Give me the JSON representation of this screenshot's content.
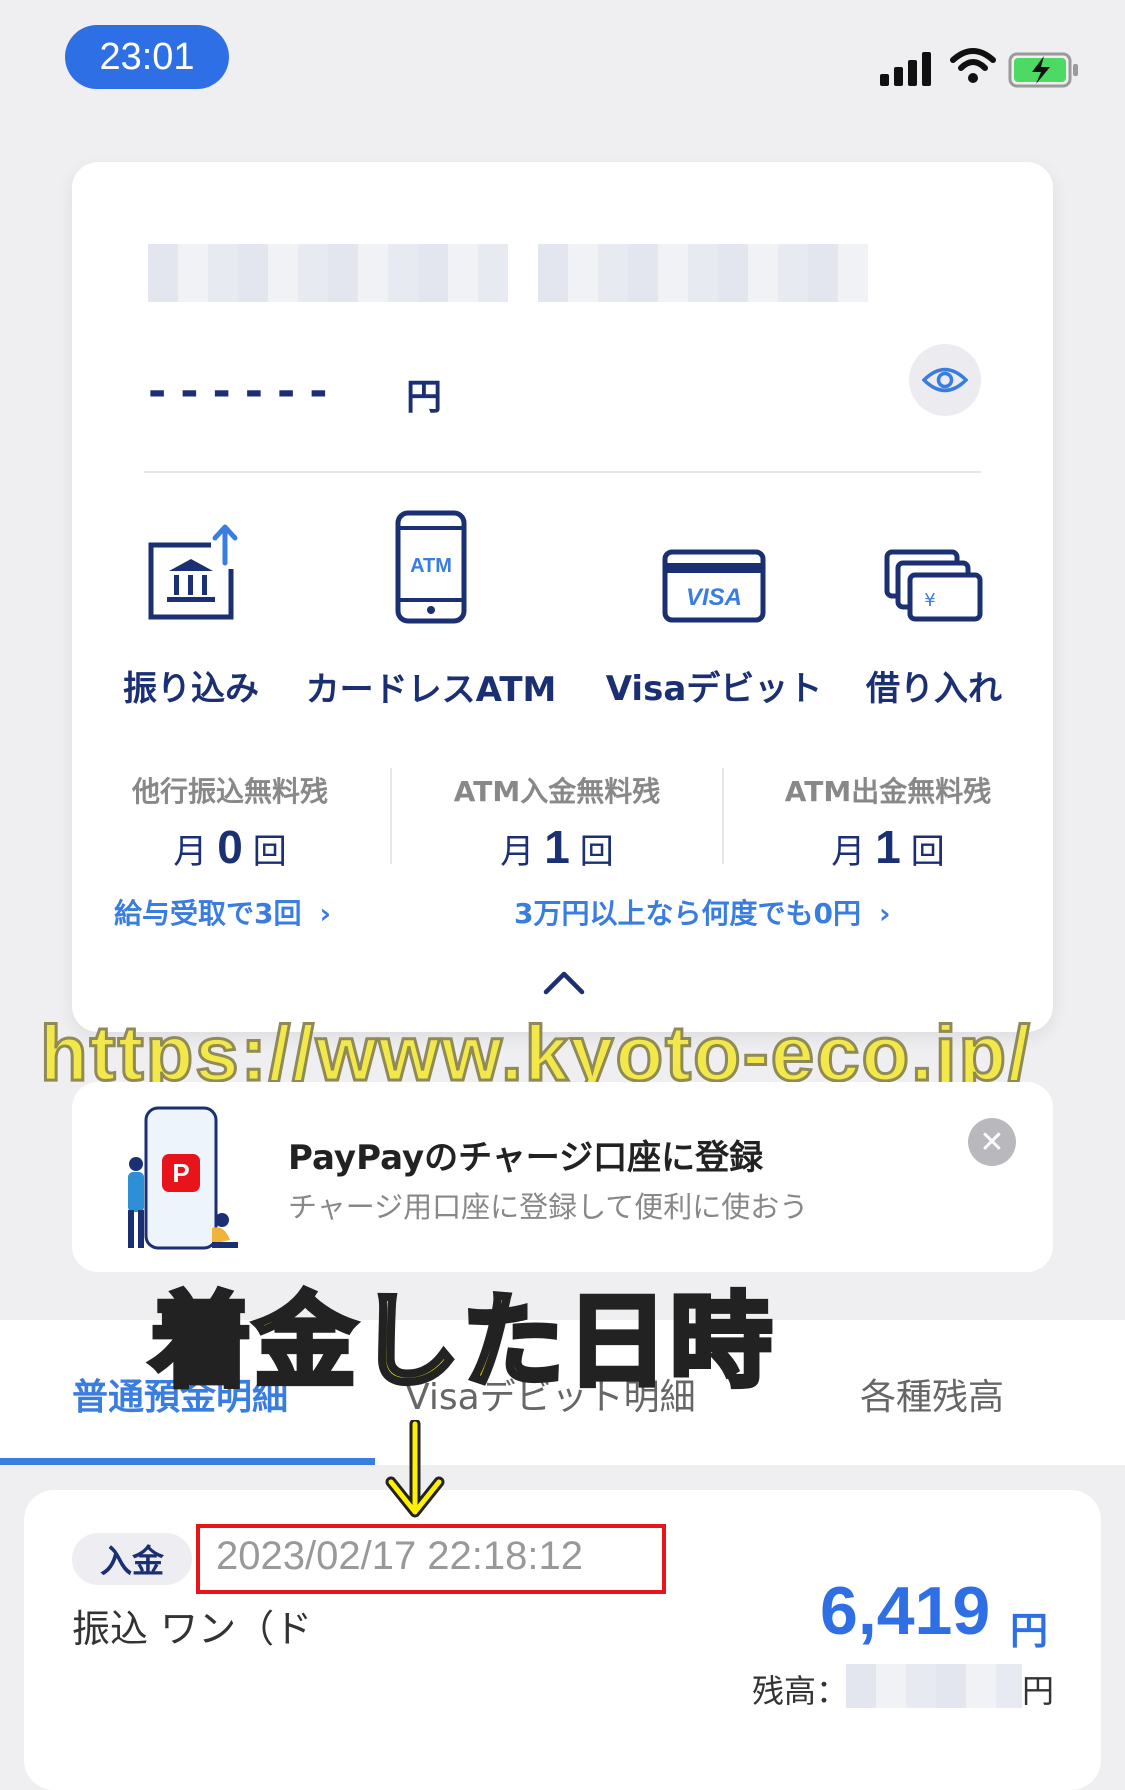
{
  "status_bar": {
    "time": "23:01"
  },
  "account": {
    "balance_masked": "------",
    "balance_unit": "円"
  },
  "actions": [
    {
      "label": "振り込み",
      "icon": "bank-transfer-icon"
    },
    {
      "label": "カードレスATM",
      "icon": "atm-phone-icon"
    },
    {
      "label": "Visaデビット",
      "icon": "visa-card-icon"
    },
    {
      "label": "借り入れ",
      "icon": "loan-cards-icon"
    }
  ],
  "free_counts": [
    {
      "title": "他行振込無料残",
      "prefix": "月",
      "count": "0",
      "suffix": "回"
    },
    {
      "title": "ATM入金無料残",
      "prefix": "月",
      "count": "1",
      "suffix": "回"
    },
    {
      "title": "ATM出金無料残",
      "prefix": "月",
      "count": "1",
      "suffix": "回"
    }
  ],
  "links": {
    "salary": "給与受取で3回",
    "over30k": "3万円以上なら何度でも0円"
  },
  "watermark": "https://www.kyoto-eco.jp/",
  "banner": {
    "title": "PayPayのチャージ口座に登録",
    "subtitle": "チャージ用口座に登録して便利に使おう",
    "logo_letter": "P"
  },
  "annotation": "着金した日時",
  "tabs": [
    {
      "label": "普通預金明細",
      "active": true
    },
    {
      "label": "Visaデビット明細",
      "active": false
    },
    {
      "label": "各種残高",
      "active": false
    }
  ],
  "transaction": {
    "type": "入金",
    "datetime": "2023/02/17 22:18:12",
    "description": "振込 ワン（ド",
    "amount": "6,419",
    "amount_unit": "円",
    "balance_label": "残高：",
    "balance_unit": "円"
  },
  "colors": {
    "accent": "#2f6fe6",
    "navy": "#1b2f73",
    "link": "#3a7de0",
    "highlight": "#e8141c",
    "annotation": "#fff200"
  }
}
